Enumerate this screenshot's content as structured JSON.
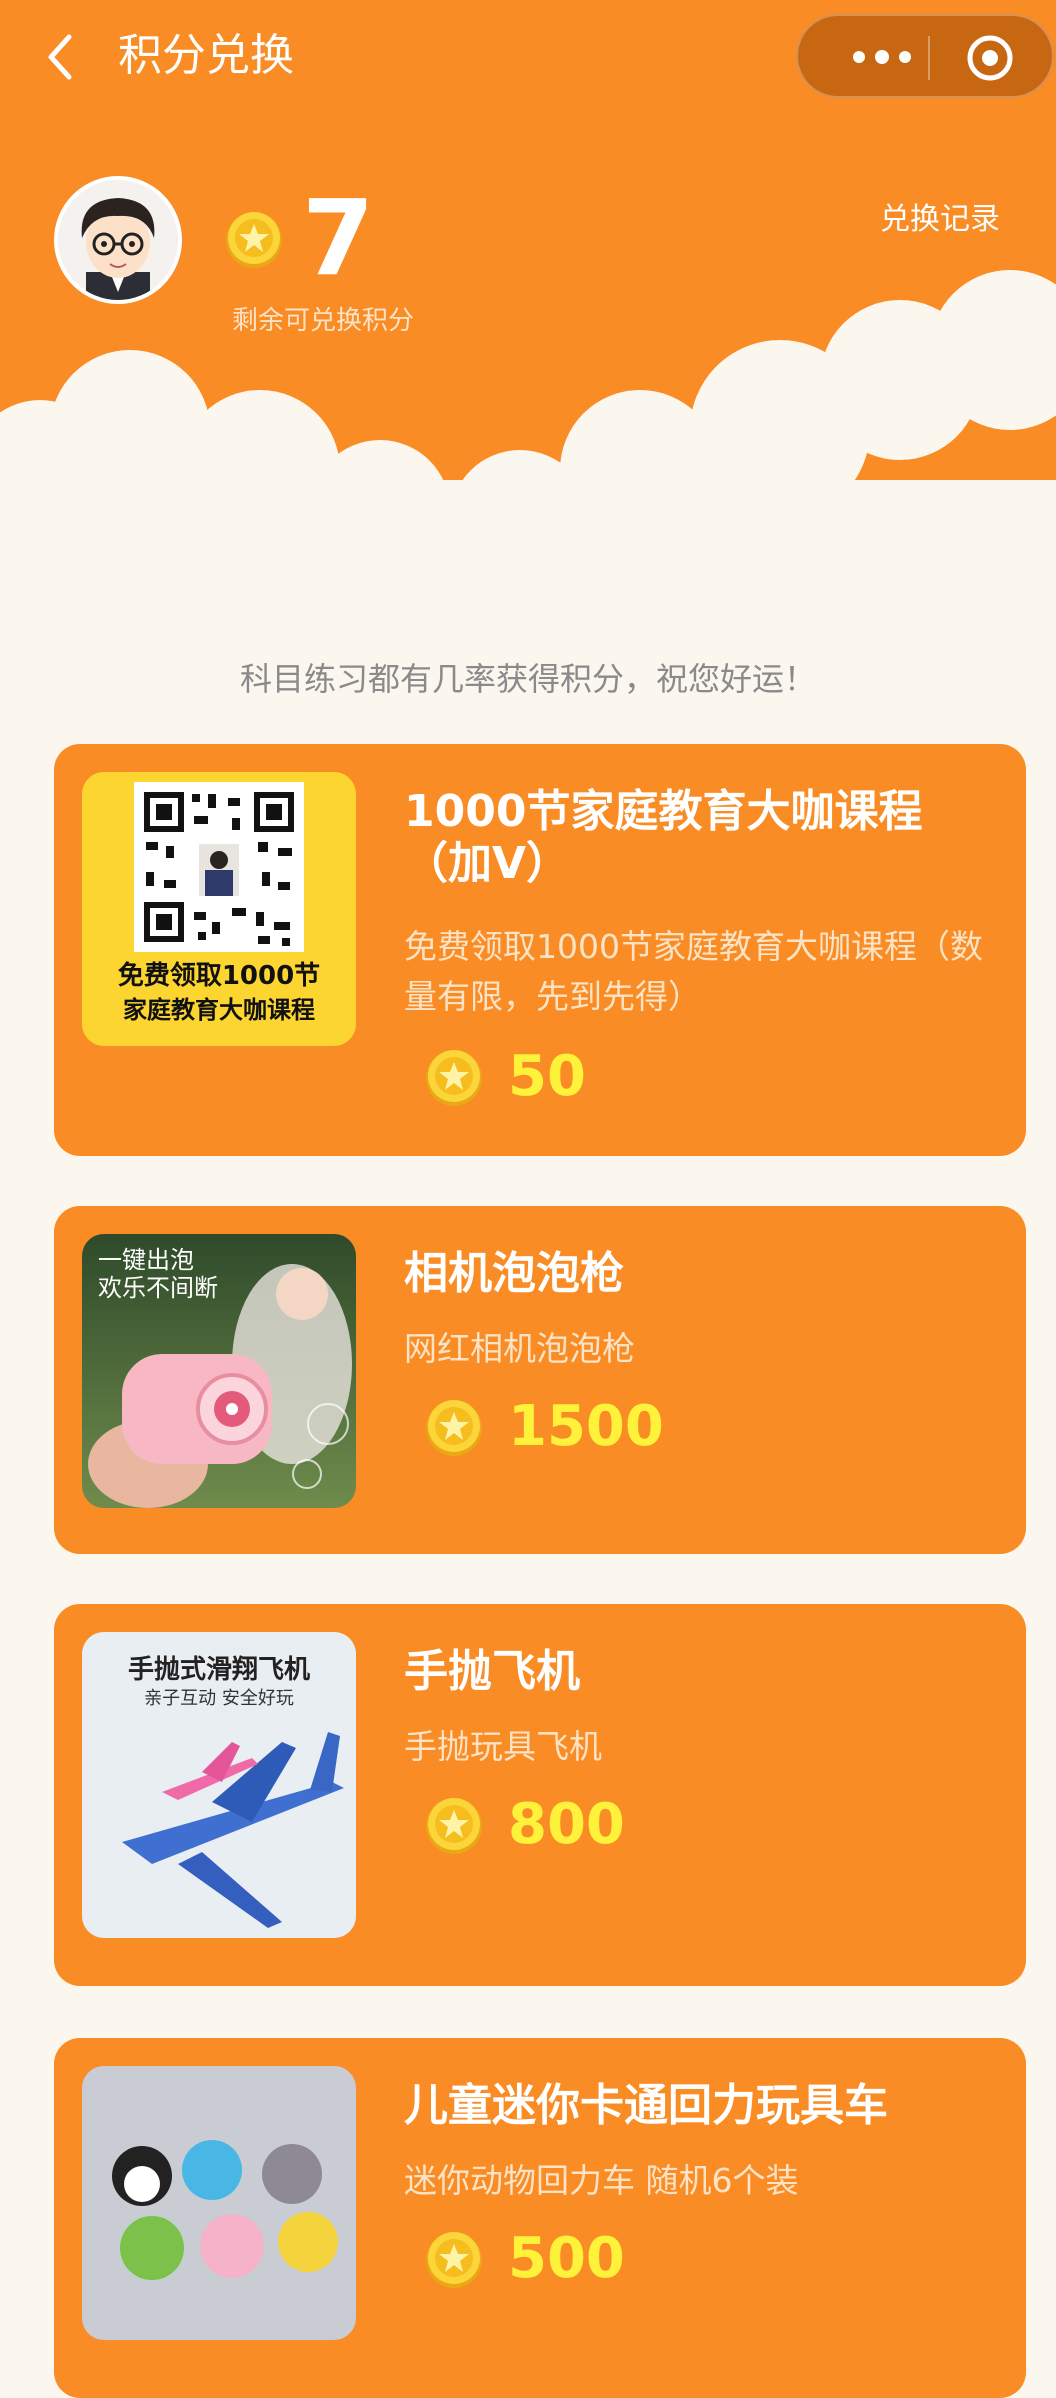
{
  "nav": {
    "title": "积分兑换"
  },
  "profile": {
    "points": "7",
    "points_label": "剩余可兑换积分",
    "history_link": "兑换记录"
  },
  "tip": "科目练习都有几率获得积分，祝您好运！",
  "products": [
    {
      "title": "1000节家庭教育大咖课程（加V）",
      "desc": "免费领取1000节家庭教育大咖课程（数量有限，先到先得）",
      "price": "50",
      "image_text": [
        "免费领取1000节",
        "家庭教育大咖课程"
      ]
    },
    {
      "title": "相机泡泡枪",
      "desc": "网红相机泡泡枪",
      "price": "1500",
      "image_text": [
        "一键出泡",
        "欢乐不间断"
      ]
    },
    {
      "title": "手抛飞机",
      "desc": "手抛玩具飞机",
      "price": "800",
      "image_text": [
        "手抛式滑翔飞机",
        "亲子互动 安全好玩"
      ]
    },
    {
      "title": "儿童迷你卡通回力玩具车",
      "desc": "迷你动物回力车 随机6个装",
      "price": "500"
    }
  ],
  "colors": {
    "brand_orange": "#f98c25",
    "price_yellow": "#fff23a",
    "page_bg": "#fbf7ef"
  }
}
